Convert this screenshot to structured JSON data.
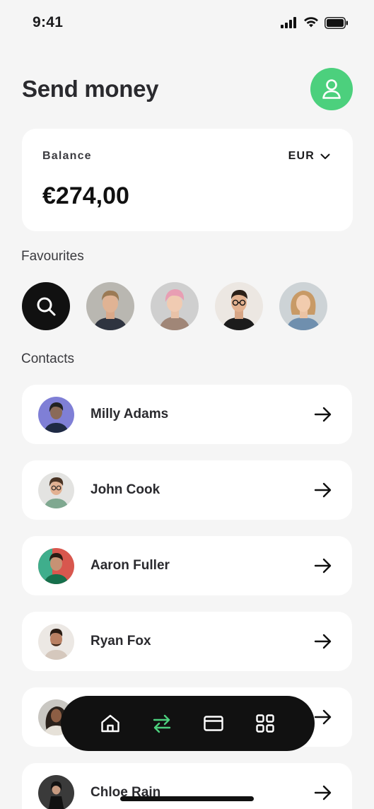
{
  "status_bar": {
    "time": "9:41"
  },
  "header": {
    "title": "Send money"
  },
  "balance": {
    "label": "Balance",
    "currency": "EUR",
    "amount": "€274,00"
  },
  "favourites": {
    "label": "Favourites",
    "items": [
      {
        "icon": "search-icon"
      },
      {
        "avatar": "avatar-man-blond"
      },
      {
        "avatar": "avatar-woman-pink-hair"
      },
      {
        "avatar": "avatar-man-glasses"
      },
      {
        "avatar": "avatar-woman-curly"
      }
    ]
  },
  "contacts": {
    "label": "Contacts",
    "items": [
      {
        "name": "Milly Adams"
      },
      {
        "name": "John Cook"
      },
      {
        "name": "Aaron Fuller"
      },
      {
        "name": "Ryan Fox"
      },
      {
        "name": ""
      },
      {
        "name": "Chloe Rain"
      }
    ]
  },
  "nav": {
    "items": [
      {
        "icon": "home-icon",
        "active": false
      },
      {
        "icon": "transfer-icon",
        "active": true
      },
      {
        "icon": "card-icon",
        "active": false
      },
      {
        "icon": "grid-icon",
        "active": false
      }
    ]
  },
  "colors": {
    "accent": "#4cd07d",
    "background": "#f5f5f5",
    "card": "#ffffff",
    "dark": "#111111"
  }
}
